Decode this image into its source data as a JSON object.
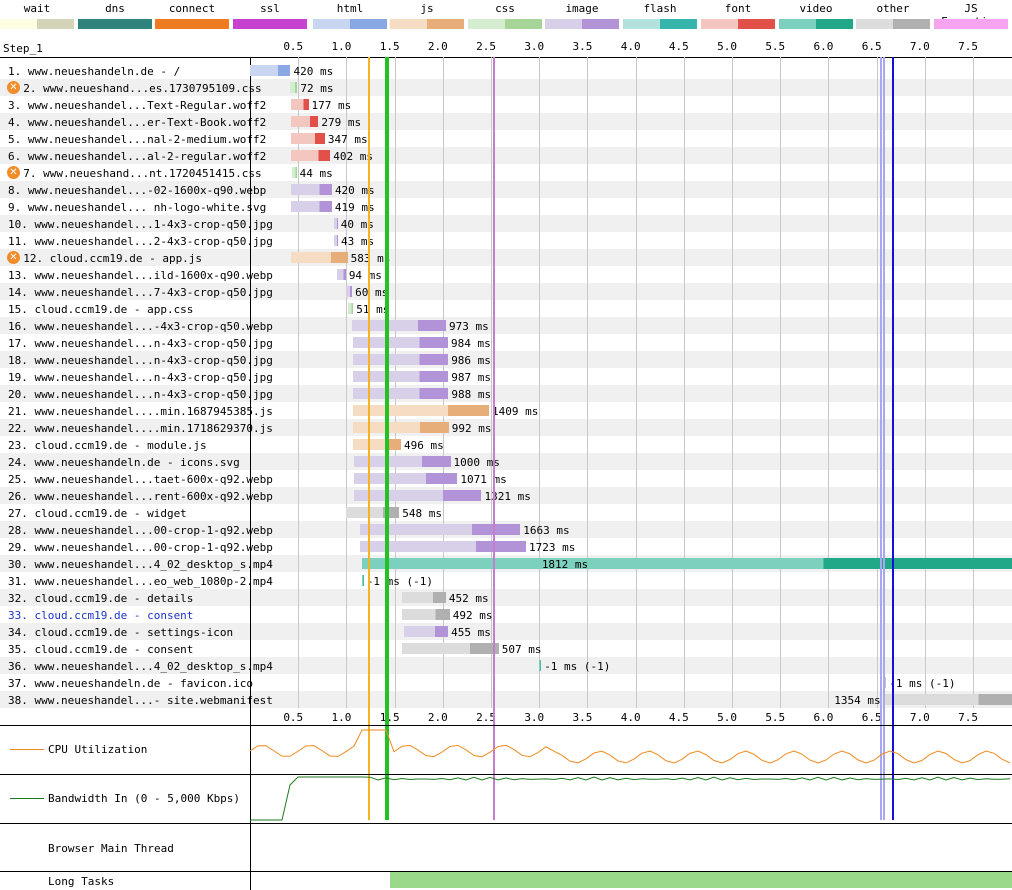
{
  "legend": [
    {
      "label": "wait",
      "c1": "#fffee0",
      "c2": "#d4d4b8"
    },
    {
      "label": "dns",
      "c1": "#30827c",
      "c2": "#30827c"
    },
    {
      "label": "connect",
      "c1": "#ef7b20",
      "c2": "#ef7b20"
    },
    {
      "label": "ssl",
      "c1": "#c641ce",
      "c2": "#c641ce"
    },
    {
      "label": "html",
      "c1": "#c8d6f2",
      "c2": "#8aa8e3"
    },
    {
      "label": "js",
      "c1": "#f5dcc2",
      "c2": "#e8ae7a"
    },
    {
      "label": "css",
      "c1": "#d4ecd0",
      "c2": "#a6d597"
    },
    {
      "label": "image",
      "c1": "#d8d0e8",
      "c2": "#b393d8"
    },
    {
      "label": "flash",
      "c1": "#b4e0de",
      "c2": "#36b5ad"
    },
    {
      "label": "font",
      "c1": "#f4c6c0",
      "c2": "#e2504a"
    },
    {
      "label": "video",
      "c1": "#7cd0be",
      "c2": "#21a889"
    },
    {
      "label": "other",
      "c1": "#dcdcdc",
      "c2": "#b0b0b0"
    },
    {
      "label": "JS Execution",
      "c1": "#f6a4f0",
      "c2": "#f6a4f0"
    }
  ],
  "step_label": "Step_1",
  "ticks": [
    "0.5",
    "1.0",
    "1.5",
    "2.0",
    "2.5",
    "3.0",
    "3.5",
    "4.0",
    "4.5",
    "5.0",
    "5.5",
    "6.0",
    "6.5",
    "7.0",
    "7.5"
  ],
  "rows": [
    {
      "label": "1. www.neueshandeln.de - /",
      "type": "html",
      "start": 0,
      "dur": 0.42,
      "text": "420 ms",
      "warn": false,
      "pre": [
        {
          "t": "dns",
          "s": 0,
          "e": 0.03
        },
        {
          "t": "connect",
          "s": 0.03,
          "e": 0.06
        },
        {
          "t": "ssl",
          "s": 0.06,
          "e": 0.14
        }
      ]
    },
    {
      "label": "2. www.neueshand...es.1730795109.css",
      "type": "css",
      "start": 0.42,
      "dur": 0.072,
      "text": "72 ms",
      "warn": true
    },
    {
      "label": "3. www.neueshandel...Text-Regular.woff2",
      "type": "font",
      "start": 0.43,
      "dur": 0.177,
      "text": "177 ms",
      "warn": false
    },
    {
      "label": "4. www.neueshandel...er-Text-Book.woff2",
      "type": "font",
      "start": 0.43,
      "dur": 0.279,
      "text": "279 ms",
      "warn": false
    },
    {
      "label": "5. www.neueshandel...nal-2-medium.woff2",
      "type": "font",
      "start": 0.43,
      "dur": 0.347,
      "text": "347 ms",
      "warn": false
    },
    {
      "label": "6. www.neueshandel...al-2-regular.woff2",
      "type": "font",
      "start": 0.43,
      "dur": 0.402,
      "text": "402 ms",
      "warn": false
    },
    {
      "label": "7. www.neueshand...nt.1720451415.css",
      "type": "css",
      "start": 0.44,
      "dur": 0.044,
      "text": "44 ms",
      "warn": true
    },
    {
      "label": "8. www.neueshandel...-02-1600x-q90.webp",
      "type": "image",
      "start": 0.43,
      "dur": 0.42,
      "text": "420 ms",
      "warn": false
    },
    {
      "label": "9. www.neueshandel... nh-logo-white.svg",
      "type": "image",
      "start": 0.43,
      "dur": 0.419,
      "text": "419 ms",
      "warn": false
    },
    {
      "label": "10. www.neueshandel...1-4x3-crop-q50.jpg",
      "type": "image",
      "start": 0.87,
      "dur": 0.04,
      "text": "40 ms",
      "warn": false
    },
    {
      "label": "11. www.neueshandel...2-4x3-crop-q50.jpg",
      "type": "image",
      "start": 0.87,
      "dur": 0.043,
      "text": "43 ms",
      "warn": false
    },
    {
      "label": "12. cloud.ccm19.de - app.js",
      "type": "js",
      "start": 0.43,
      "dur": 0.583,
      "text": "583 ms",
      "warn": true,
      "pre": [
        {
          "t": "dns",
          "s": 0.43,
          "e": 0.6
        },
        {
          "t": "connect",
          "s": 0.6,
          "e": 0.66
        },
        {
          "t": "ssl",
          "s": 0.66,
          "e": 0.87
        }
      ]
    },
    {
      "label": "13. www.neueshandel...ild-1600x-q90.webp",
      "type": "image",
      "start": 0.9,
      "dur": 0.094,
      "text": "94 ms",
      "warn": false
    },
    {
      "label": "14. www.neueshandel...7-4x3-crop-q50.jpg",
      "type": "image",
      "start": 1.0,
      "dur": 0.06,
      "text": "60 ms",
      "warn": false
    },
    {
      "label": "15. cloud.ccm19.de - app.css",
      "type": "css",
      "start": 1.02,
      "dur": 0.051,
      "text": "51 ms",
      "warn": false
    },
    {
      "label": "16. www.neueshandel...-4x3-crop-q50.webp",
      "type": "image",
      "start": 1.06,
      "dur": 0.973,
      "text": "973 ms",
      "warn": false
    },
    {
      "label": "17. www.neueshandel...n-4x3-crop-q50.jpg",
      "type": "image",
      "start": 1.07,
      "dur": 0.984,
      "text": "984 ms",
      "warn": false
    },
    {
      "label": "18. www.neueshandel...n-4x3-crop-q50.jpg",
      "type": "image",
      "start": 1.07,
      "dur": 0.986,
      "text": "986 ms",
      "warn": false
    },
    {
      "label": "19. www.neueshandel...n-4x3-crop-q50.jpg",
      "type": "image",
      "start": 1.07,
      "dur": 0.987,
      "text": "987 ms",
      "warn": false
    },
    {
      "label": "20. www.neueshandel...n-4x3-crop-q50.jpg",
      "type": "image",
      "start": 1.07,
      "dur": 0.988,
      "text": "988 ms",
      "warn": false
    },
    {
      "label": "21. www.neueshandel....min.1687945385.js",
      "type": "js",
      "start": 1.07,
      "dur": 1.409,
      "text": "1409 ms",
      "warn": false
    },
    {
      "label": "22. www.neueshandel....min.1718629370.js",
      "type": "js",
      "start": 1.07,
      "dur": 0.992,
      "text": "992 ms",
      "warn": false
    },
    {
      "label": "23. cloud.ccm19.de - module.js",
      "type": "js",
      "start": 1.07,
      "dur": 0.496,
      "text": "496 ms",
      "warn": false
    },
    {
      "label": "24. www.neueshandeln.de - icons.svg",
      "type": "image",
      "start": 1.08,
      "dur": 1.0,
      "text": "1000 ms",
      "warn": false
    },
    {
      "label": "25. www.neueshandel...taet-600x-q92.webp",
      "type": "image",
      "start": 1.08,
      "dur": 1.071,
      "text": "1071 ms",
      "warn": false
    },
    {
      "label": "26. www.neueshandel...rent-600x-q92.webp",
      "type": "image",
      "start": 1.08,
      "dur": 1.321,
      "text": "1321 ms",
      "warn": false
    },
    {
      "label": "27. cloud.ccm19.de - widget",
      "type": "other",
      "start": 1.0,
      "dur": 0.548,
      "text": "548 ms",
      "warn": false,
      "pre": [
        {
          "t": "connect",
          "s": 1.0,
          "e": 1.05
        },
        {
          "t": "ssl",
          "s": 1.05,
          "e": 1.1
        }
      ]
    },
    {
      "label": "28. www.neueshandel...00-crop-1-q92.webp",
      "type": "image",
      "start": 1.14,
      "dur": 1.663,
      "text": "1663 ms",
      "warn": false
    },
    {
      "label": "29. www.neueshandel...00-crop-1-q92.webp",
      "type": "image",
      "start": 1.14,
      "dur": 1.723,
      "text": "1723 ms",
      "warn": false
    },
    {
      "label": "30. www.neueshandel...4_02_desktop_s.mp4",
      "type": "video",
      "start": 1.16,
      "dur": 6.84,
      "text": "1812 ms",
      "warn": false,
      "inside": true
    },
    {
      "label": "31. www.neueshandel...eo_web_1080p-2.mp4",
      "type": "video",
      "start": 1.16,
      "dur": 0.01,
      "text": "-1 ms (-1)",
      "warn": false
    },
    {
      "label": "32. cloud.ccm19.de - details",
      "type": "other",
      "start": 1.58,
      "dur": 0.452,
      "text": "452 ms",
      "warn": false
    },
    {
      "label": "33. cloud.ccm19.de - consent",
      "type": "other",
      "start": 1.58,
      "dur": 0.492,
      "text": "492 ms",
      "warn": false,
      "blue": true
    },
    {
      "label": "34. cloud.ccm19.de - settings-icon",
      "type": "image",
      "start": 1.6,
      "dur": 0.455,
      "text": "455 ms",
      "warn": false
    },
    {
      "label": "35. cloud.ccm19.de - consent",
      "type": "other",
      "start": 1.58,
      "dur": 1.0,
      "text": "507 ms",
      "warn": false
    },
    {
      "label": "36. www.neueshandel...4_02_desktop_s.mp4",
      "type": "video",
      "start": 3.0,
      "dur": 0.01,
      "text": "-1 ms (-1)",
      "warn": false
    },
    {
      "label": "37. www.neueshandeln.de - favicon.ico",
      "type": "other",
      "start": 6.58,
      "dur": 0.0,
      "text": "-1 ms (-1)",
      "warn": false
    },
    {
      "label": "38. www.neueshandel...- site.webmanifest",
      "type": "other",
      "start": 6.58,
      "dur": 1.4,
      "text": "1354 ms",
      "warn": false,
      "left": true,
      "pre": [
        {
          "t": "connect",
          "s": 6.58,
          "e": 7.0
        },
        {
          "t": "ssl",
          "s": 7.0,
          "e": 7.45
        }
      ]
    }
  ],
  "vlines": [
    {
      "t": 1.23,
      "color": "#f5b321",
      "w": 2
    },
    {
      "t": 1.42,
      "color": "#22c222",
      "w": 4
    },
    {
      "t": 2.53,
      "color": "#c77ccf",
      "w": 2
    },
    {
      "t": 6.55,
      "color": "#a8a8f0",
      "w": 2
    },
    {
      "t": 6.58,
      "color": "#a8a8f0",
      "w": 2
    },
    {
      "t": 6.67,
      "color": "#1010d8",
      "w": 2
    }
  ],
  "bottom": {
    "cpu": "CPU Utilization",
    "bandwidth": "Bandwidth In (0 - 5,000 Kbps)",
    "main_thread": "Browser Main Thread",
    "long_tasks": "Long Tasks"
  }
}
